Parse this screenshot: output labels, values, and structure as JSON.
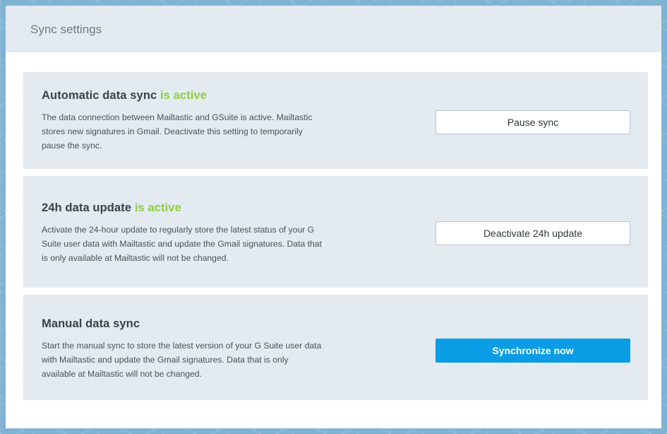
{
  "dialog": {
    "title": "Sync settings"
  },
  "cards": [
    {
      "title": "Automatic data sync",
      "status": "is active",
      "description": "The data connection between Mailtastic and GSuite is active. Mailtastic stores new signatures in Gmail. Deactivate this setting to temporarily pause the sync.",
      "button_label": "Pause sync"
    },
    {
      "title": "24h data update",
      "status": "is active",
      "description": "Activate the 24-hour update to regularly store the latest status of your G Suite user data with Mailtastic and update the Gmail signatures. Data that is only available at Mailtastic will not be changed.",
      "button_label": "Deactivate 24h update"
    },
    {
      "title": "Manual data sync",
      "description": "Start the manual sync to store the latest version of your G Suite user data with Mailtastic and update the Gmail signatures. Data that is only available at Mailtastic will not be changed.",
      "button_label": "Synchronize now"
    }
  ],
  "colors": {
    "status_active": "#8fcf3d",
    "primary_button": "#0a9de5",
    "card_background": "#e3eaf0"
  }
}
